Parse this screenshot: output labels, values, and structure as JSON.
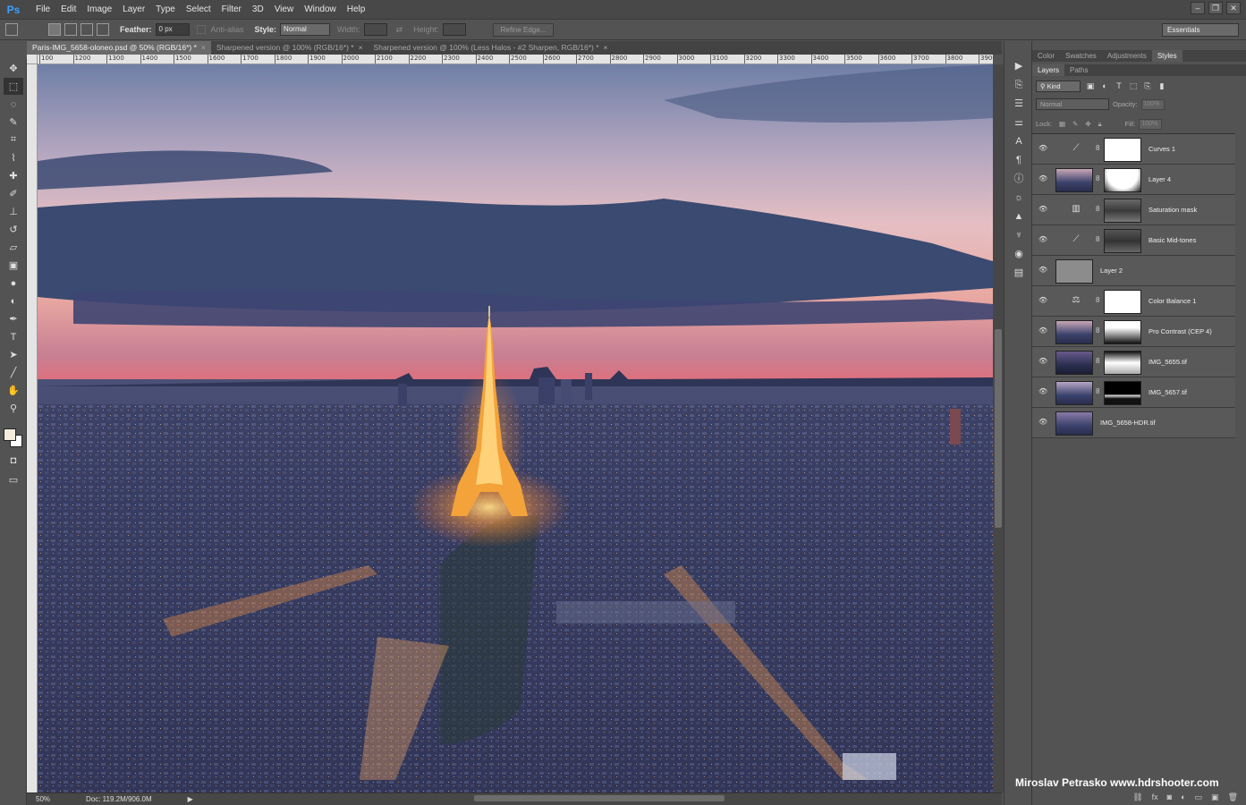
{
  "app": {
    "logo": "Ps"
  },
  "menu": [
    "File",
    "Edit",
    "Image",
    "Layer",
    "Type",
    "Select",
    "Filter",
    "3D",
    "View",
    "Window",
    "Help"
  ],
  "window_controls": [
    "–",
    "❐",
    "✕"
  ],
  "options": {
    "feather_label": "Feather:",
    "feather_value": "0 px",
    "antialias_label": "Anti-alias",
    "style_label": "Style:",
    "style_value": "Normal",
    "width_label": "Width:",
    "height_label": "Height:",
    "refine_edge": "Refine Edge...",
    "workspace": "Essentials"
  },
  "doc_tabs": [
    {
      "label": "Paris-IMG_5658-oloneo.psd @ 50% (RGB/16*) *",
      "close": "×",
      "active": true
    },
    {
      "label": "Sharpened version @ 100% (RGB/16*) *",
      "close": "×",
      "active": false
    },
    {
      "label": "Sharpened version @ 100% (Less Halos - #2 Sharpen, RGB/16*) *",
      "close": "×",
      "active": false
    }
  ],
  "ruler_labels": [
    "100",
    "1200",
    "1300",
    "1400",
    "1500",
    "1600",
    "1700",
    "1800",
    "1900",
    "2000",
    "2100",
    "2200",
    "2300",
    "2400",
    "2500",
    "2600",
    "2700",
    "2800",
    "2900",
    "3000",
    "3100",
    "3200",
    "3300",
    "3400",
    "3500",
    "3600",
    "3700",
    "3800",
    "3900"
  ],
  "status": {
    "zoom": "50%",
    "doc": "Doc: 119.2M/906.0M"
  },
  "panels": {
    "top_tabs": [
      "Color",
      "Swatches",
      "Adjustments",
      "Styles"
    ],
    "layer_tabs": [
      "Layers",
      "Paths"
    ],
    "kind": "Kind",
    "blend_mode": "Normal",
    "opacity_label": "Opacity:",
    "opacity_value": "100%",
    "lock_label": "Lock:",
    "fill_label": "Fill:",
    "fill_value": "100%"
  },
  "layers": [
    {
      "name": "Curves 1",
      "type": "adjustment",
      "icon": "curves-icon"
    },
    {
      "name": "Layer 4",
      "type": "masked-photo"
    },
    {
      "name": "Saturation mask",
      "type": "adjustment",
      "icon": "levels-icon"
    },
    {
      "name": "Basic Mid-tones",
      "type": "adjustment",
      "icon": "curves-icon"
    },
    {
      "name": "Layer 2",
      "type": "gray"
    },
    {
      "name": "Color Balance 1",
      "type": "adjustment",
      "icon": "balance-icon"
    },
    {
      "name": "Pro Contrast (CEP 4)",
      "type": "masked-photo"
    },
    {
      "name": "IMG_5655.tif",
      "type": "masked-photo"
    },
    {
      "name": "IMG_5657.tif",
      "type": "masked-photo"
    },
    {
      "name": "IMG_5658-HDR.tif",
      "type": "photo"
    }
  ],
  "watermark": "Miroslav  Petrasko  www.hdrshooter.com",
  "colors": {
    "accent": "#3aa0ff",
    "panel": "#535353",
    "dark": "#434343"
  }
}
